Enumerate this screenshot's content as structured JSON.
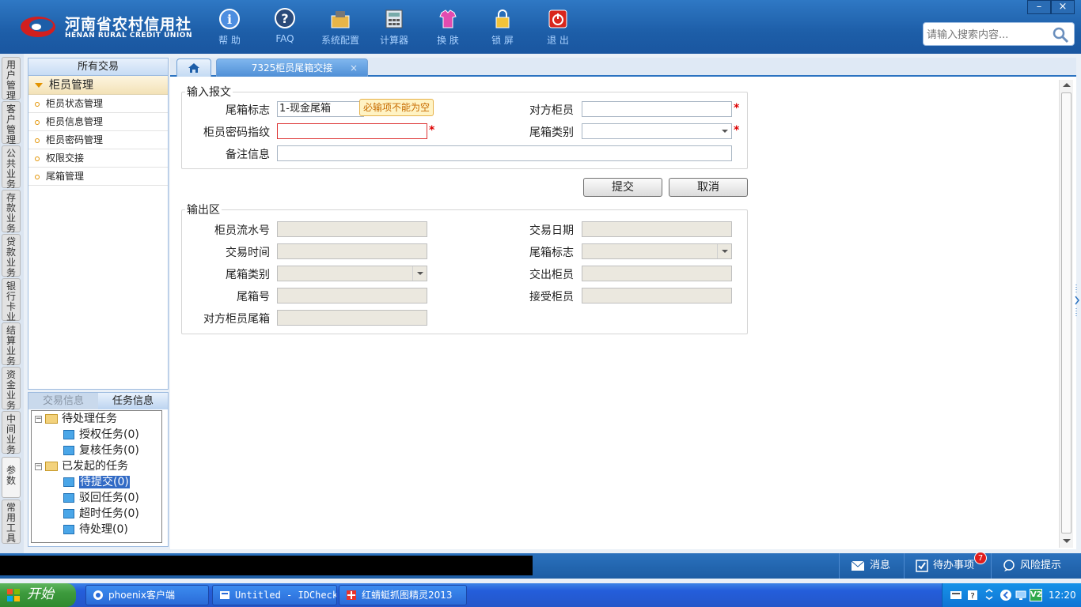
{
  "app": {
    "logo_cn": "河南省农村信用社",
    "logo_en": "HENAN RURAL CREDIT UNION",
    "toolbar": [
      {
        "label": "帮 助",
        "icon": "help-icon"
      },
      {
        "label": "FAQ",
        "icon": "faq-icon"
      },
      {
        "label": "系统配置",
        "icon": "config-icon"
      },
      {
        "label": "计算器",
        "icon": "calculator-icon"
      },
      {
        "label": "换 肤",
        "icon": "skin-icon"
      },
      {
        "label": "锁 屏",
        "icon": "lock-icon"
      },
      {
        "label": "退 出",
        "icon": "exit-icon"
      }
    ],
    "window_controls": {
      "minimize": "–",
      "close": "×"
    },
    "search": {
      "placeholder": "请输入搜索内容..."
    }
  },
  "vertical_tabs": [
    "用户管理",
    "客户管理",
    "公共业务",
    "存款业务",
    "贷款业务",
    "银行卡业务",
    "结算业务",
    "资金业务",
    "中间业务",
    "参数",
    "常用工具"
  ],
  "sidebar": {
    "header": "所有交易",
    "group": "柜员管理",
    "items": [
      "柜员状态管理",
      "柜员信息管理",
      "柜员密码管理",
      "权限交接",
      "尾箱管理"
    ]
  },
  "task_panel": {
    "tabs": [
      "交易信息",
      "任务信息"
    ],
    "tree": {
      "pending_group": "待处理任务",
      "pending_items": [
        "授权任务(0)",
        "复核任务(0)"
      ],
      "initiated_group": "已发起的任务",
      "initiated_items": [
        "待提交(0)",
        "驳回任务(0)",
        "超时任务(0)",
        "待处理(0)"
      ]
    }
  },
  "tabs": {
    "home_icon": "home-icon",
    "active": "7325柜员尾箱交接",
    "close": "×"
  },
  "form": {
    "input_legend": "输入报文",
    "tail_box_flag_label": "尾箱标志",
    "tail_box_flag_value": "1-现金尾箱",
    "tooltip": "必输项不能为空",
    "counterpart_teller_label": "对方柜员",
    "counterpart_teller_value": "",
    "teller_password_label": "柜员密码指纹",
    "tail_box_type_label": "尾箱类别",
    "remark_label": "备注信息",
    "required_mark": "*",
    "submit_label": "提交",
    "cancel_label": "取消",
    "output_legend": "输出区",
    "out_teller_serial_label": "柜员流水号",
    "out_trade_date_label": "交易日期",
    "out_trade_time_label": "交易时间",
    "out_tail_box_flag_label": "尾箱标志",
    "out_tail_box_type_label": "尾箱类别",
    "out_handover_teller_label": "交出柜员",
    "out_tail_box_no_label": "尾箱号",
    "out_receiver_teller_label": "接受柜员",
    "out_counterpart_box_label": "对方柜员尾箱"
  },
  "statusbar": {
    "message": "消息",
    "todo": "待办事项",
    "todo_count": "7",
    "risk": "风险提示"
  },
  "taskbar": {
    "start": "开始",
    "tasks": [
      "phoenix客户端",
      "Untitled - IDCheck",
      "红蜻蜓抓图精灵2013"
    ],
    "clock": "12:20",
    "tray_label": "V2"
  },
  "colors": {
    "brand_blue": "#1d5ea8",
    "required_red": "#d00",
    "tooltip_orange": "#c76b00"
  }
}
